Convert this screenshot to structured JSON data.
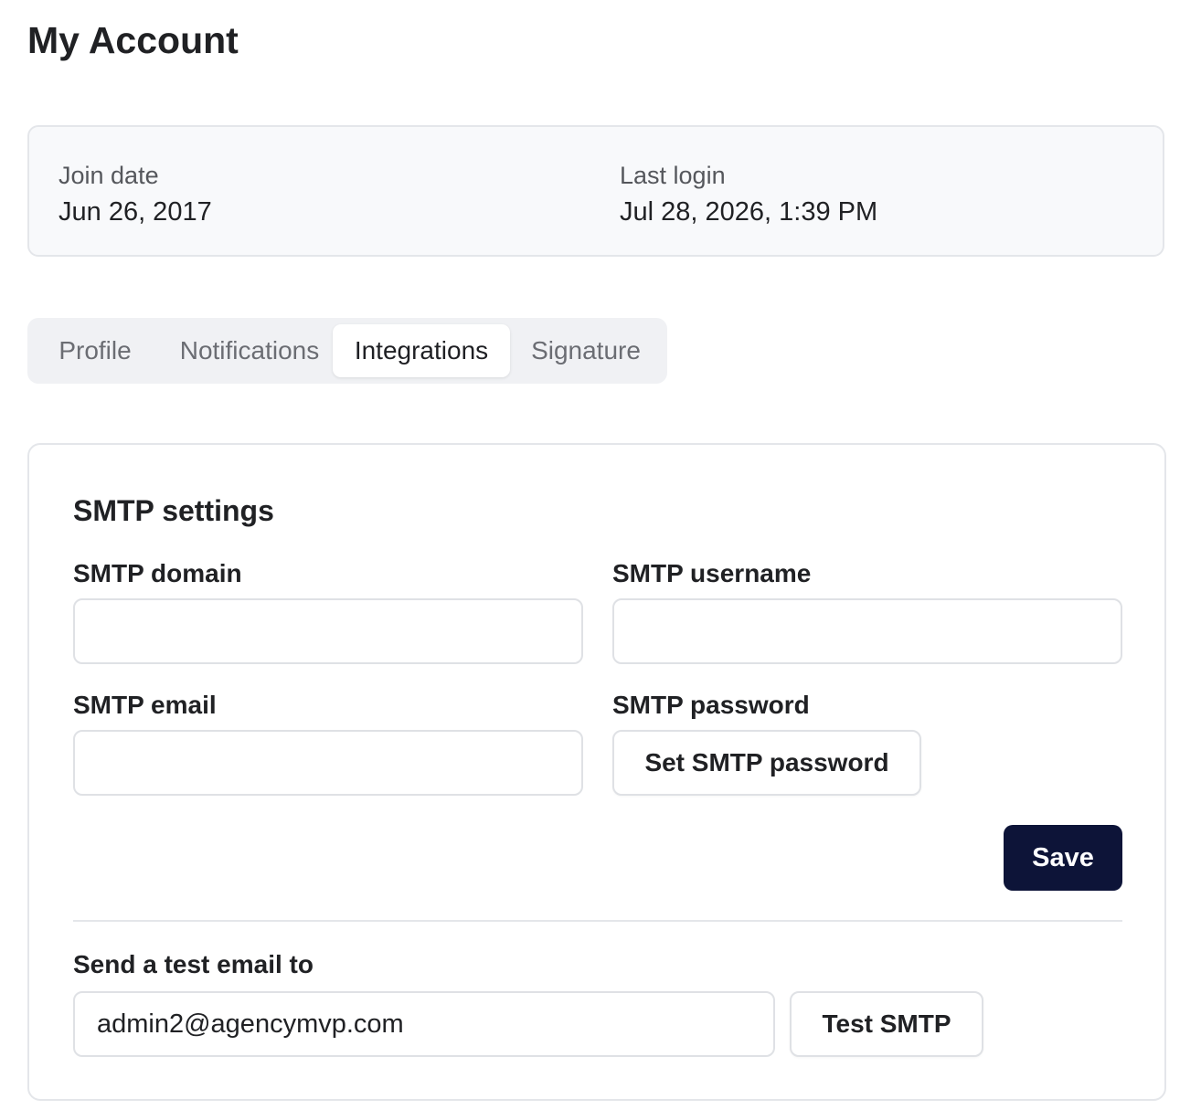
{
  "page": {
    "title": "My Account"
  },
  "account_meta": {
    "join_date_label": "Join date",
    "join_date_value": "Jun 26, 2017",
    "last_login_label": "Last login",
    "last_login_value": "Jul 28, 2026, 1:39 PM"
  },
  "tabs": [
    {
      "label": "Profile",
      "active": false
    },
    {
      "label": "Notifications",
      "active": false
    },
    {
      "label": "Integrations",
      "active": true
    },
    {
      "label": "Signature",
      "active": false
    }
  ],
  "smtp": {
    "section_title": "SMTP settings",
    "domain_label": "SMTP domain",
    "domain_value": "",
    "username_label": "SMTP username",
    "username_value": "",
    "email_label": "SMTP email",
    "email_value": "",
    "password_label": "SMTP password",
    "set_password_button": "Set SMTP password",
    "save_button": "Save"
  },
  "test_email": {
    "label": "Send a test email to",
    "value": "admin2@agencymvp.com",
    "button": "Test SMTP"
  },
  "colors": {
    "primary_button": "#0d1438",
    "card_background": "#f8f9fb",
    "tabs_background": "#f0f1f4",
    "border": "#e4e6ea"
  }
}
